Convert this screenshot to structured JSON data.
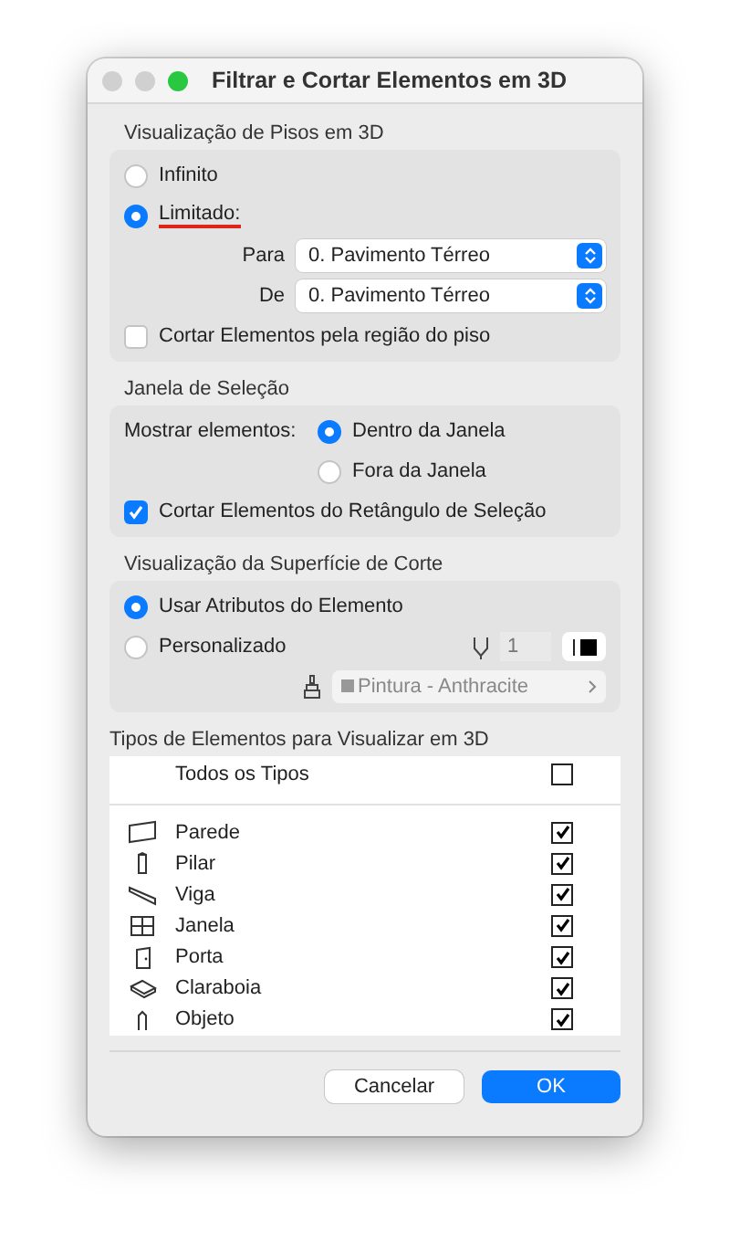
{
  "window": {
    "title": "Filtrar e Cortar Elementos em 3D"
  },
  "floor_section": {
    "title": "Visualização de Pisos em 3D",
    "options": [
      {
        "label": "Infinito",
        "selected": false
      },
      {
        "label": "Limitado:",
        "selected": true
      }
    ],
    "fields": [
      {
        "label": "Para",
        "value": "0. Pavimento Térreo"
      },
      {
        "label": "De",
        "value": "0. Pavimento Térreo"
      }
    ],
    "checkbox": {
      "label": "Cortar Elementos pela região do piso",
      "checked": false
    }
  },
  "selection_section": {
    "title": "Janela de Seleção",
    "show_label": "Mostrar elementos:",
    "options": [
      {
        "label": "Dentro da Janela",
        "selected": true
      },
      {
        "label": "Fora da Janela",
        "selected": false
      }
    ],
    "checkbox": {
      "label": "Cortar Elementos do Retângulo de Seleção",
      "checked": true
    }
  },
  "cut_surface_section": {
    "title": "Visualização da Superfície de Corte",
    "options": [
      {
        "label": "Usar Atributos do Elemento",
        "selected": true
      },
      {
        "label": "Personalizado",
        "selected": false
      }
    ],
    "pen_value": "1",
    "material": "Pintura - Anthracite",
    "disabled": true
  },
  "element_types": {
    "title": "Tipos de Elementos para Visualizar em 3D",
    "all": {
      "label": "Todos os Tipos",
      "checked": false
    },
    "items": [
      {
        "label": "Parede",
        "checked": true
      },
      {
        "label": "Pilar",
        "checked": true
      },
      {
        "label": "Viga",
        "checked": true
      },
      {
        "label": "Janela",
        "checked": true
      },
      {
        "label": "Porta",
        "checked": true
      },
      {
        "label": "Claraboia",
        "checked": true
      },
      {
        "label": "Objeto",
        "checked": true
      }
    ]
  },
  "buttons": [
    {
      "label": "Cancelar",
      "primary": false
    },
    {
      "label": "OK",
      "primary": true
    }
  ]
}
